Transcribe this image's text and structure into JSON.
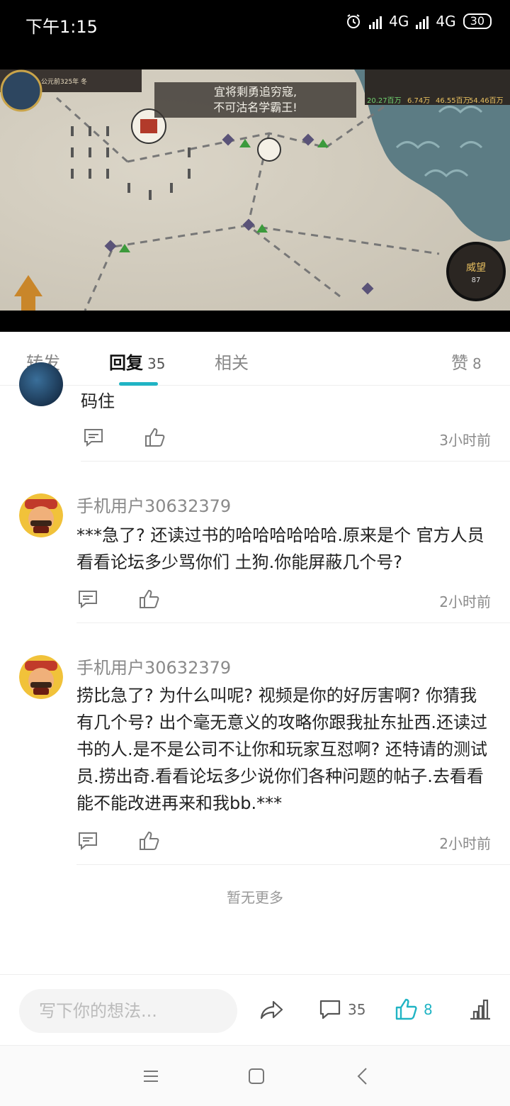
{
  "status_bar": {
    "time": "下午1:15",
    "network_1": "4G",
    "network_2": "4G",
    "battery": "30"
  },
  "video": {
    "banner_line1": "宜将剩勇追穷寇,",
    "banner_line2": "不可沽名学霸王!",
    "hud_year": "公元前325年 冬",
    "hud_resources": [
      "20.27百万",
      "6.74万",
      "46.55百万",
      "54.46百万"
    ],
    "hud_prestige": "威望",
    "hud_prestige_value": "87"
  },
  "tabs": {
    "repost": "转发",
    "reply": "回复",
    "reply_count": "35",
    "related": "相关",
    "like": "赞",
    "like_count": "8"
  },
  "comments": [
    {
      "username": "",
      "text": "码住",
      "time": "3小时前"
    },
    {
      "username": "手机用户30632379",
      "text": "***急了? 还读过书的哈哈哈哈哈哈.原来是个 官方人员看看论坛多少骂你们 土狗.你能屏蔽几个号?",
      "time": "2小时前"
    },
    {
      "username": "手机用户30632379",
      "text": "捞比急了? 为什么叫呢? 视频是你的好厉害啊? 你猜我有几个号? 出个毫无意义的攻略你跟我扯东扯西.还读过书的人.是不是公司不让你和玩家互怼啊? 还特请的测试员.捞出奇.看看论坛多少说你们各种问题的帖子.去看看能不能改进再来和我bb.***",
      "time": "2小时前"
    }
  ],
  "no_more": "暂无更多",
  "bottom_bar": {
    "input_placeholder": "写下你的想法...",
    "comment_count": "35",
    "like_count": "8"
  },
  "colors": {
    "accent": "#20b4c4",
    "text": "#222222",
    "muted": "#8a8a8a"
  }
}
